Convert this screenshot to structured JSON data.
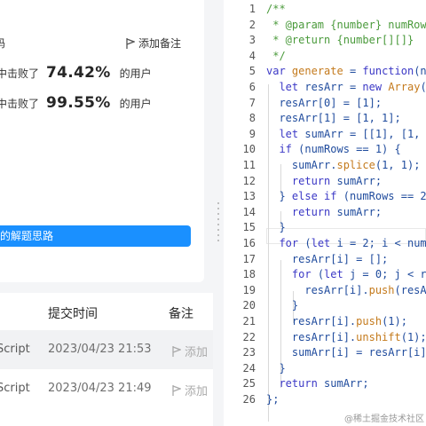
{
  "left_panel": {
    "header_partial": "码",
    "add_note_label": "添加备注",
    "stat_runtime": {
      "prefix": "中击败了",
      "value": "74.42%",
      "suffix": "的用户"
    },
    "stat_memory": {
      "prefix": "中击败了",
      "value": "99.55%",
      "suffix": "的用户"
    },
    "solution_button": "的解题思路"
  },
  "submissions": {
    "headers": {
      "time": "提交时间",
      "note": "备注"
    },
    "rows": [
      {
        "language": "Script",
        "time": "2023/04/23 21:53",
        "note": "添加"
      },
      {
        "language": "Script",
        "time": "2023/04/23 21:49",
        "note": "添加"
      }
    ]
  },
  "editor": {
    "line_numbers": [
      "1",
      "2",
      "3",
      "4",
      "5",
      "6",
      "7",
      "8",
      "9",
      "10",
      "11",
      "12",
      "13",
      "14",
      "15",
      "16",
      "17",
      "18",
      "19",
      "20",
      "21",
      "22",
      "23",
      "24",
      "25",
      "26"
    ],
    "lines": [
      "/**",
      " * @param {number} numRows",
      " * @return {number[][]}",
      " */",
      "var generate = function(numRows) {",
      "  let resArr = new Array(",
      "  resArr[0] = [1];",
      "  resArr[1] = [1, 1];",
      "  let sumArr = [[1], [1, 1]];",
      "  if (numRows == 1) {",
      "    sumArr.splice(1, 1);",
      "    return sumArr;",
      "  } else if (numRows == 2) {",
      "    return sumArr;",
      "  }",
      "  for (let i = 2; i < numRows",
      "    resArr[i] = [];",
      "    for (let j = 0; j < resArr",
      "      resArr[i].push(resArr",
      "    }",
      "    resArr[i].push(1);",
      "    resArr[i].unshift(1);",
      "    sumArr[i] = resArr[i]",
      "  }",
      "  return sumArr;",
      "};"
    ],
    "watermark": "@稀土掘金技术社区"
  },
  "colors": {
    "accent": "#1a90ff",
    "comment": "#4a9a3b",
    "keyword": "#3b38c6",
    "function": "#c47a1c"
  }
}
